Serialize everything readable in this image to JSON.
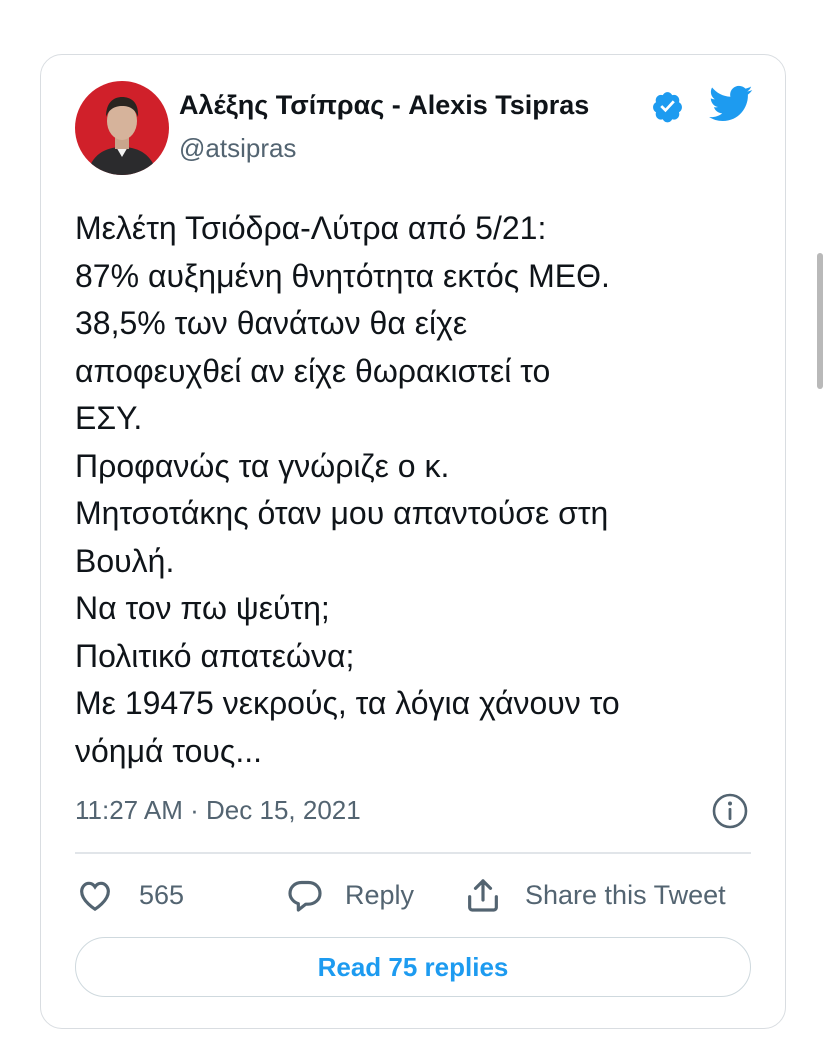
{
  "author": {
    "display_name": "Αλέξης Τσίπρας - Alexis Tsipras",
    "handle": "@atsipras",
    "verified": true
  },
  "tweet": {
    "lines": [
      "Μελέτη Τσιόδρα-Λύτρα από 5/21:",
      "87% αυξημένη θνητότητα εκτός ΜΕΘ.",
      "38,5% των θανάτων θα είχε",
      "αποφευχθεί αν είχε θωρακιστεί το",
      "ΕΣΥ.",
      "Προφανώς τα γνώριζε ο κ.",
      "Μητσοτάκης όταν μου απαντούσε στη",
      "Βουλή.",
      "Να τον πω ψεύτη;",
      "Πολιτικό απατεώνα;",
      "Με 19475 νεκρούς, τα λόγια χάνουν το",
      "νόημά τους..."
    ],
    "timestamp": "11:27 AM · Dec 15, 2021"
  },
  "actions": {
    "likes_count": "565",
    "reply_label": "Reply",
    "share_label": "Share this Tweet"
  },
  "read_replies_label": "Read 75 replies",
  "icons": {
    "verified": "verified-badge-icon",
    "logo": "twitter-bird-icon",
    "info": "info-icon",
    "like": "heart-icon",
    "reply": "speech-bubble-icon",
    "share": "share-upload-icon"
  },
  "colors": {
    "accent": "#1d9bf0",
    "text": "#0f1419",
    "secondary": "#536471",
    "border": "#d9dde1"
  }
}
